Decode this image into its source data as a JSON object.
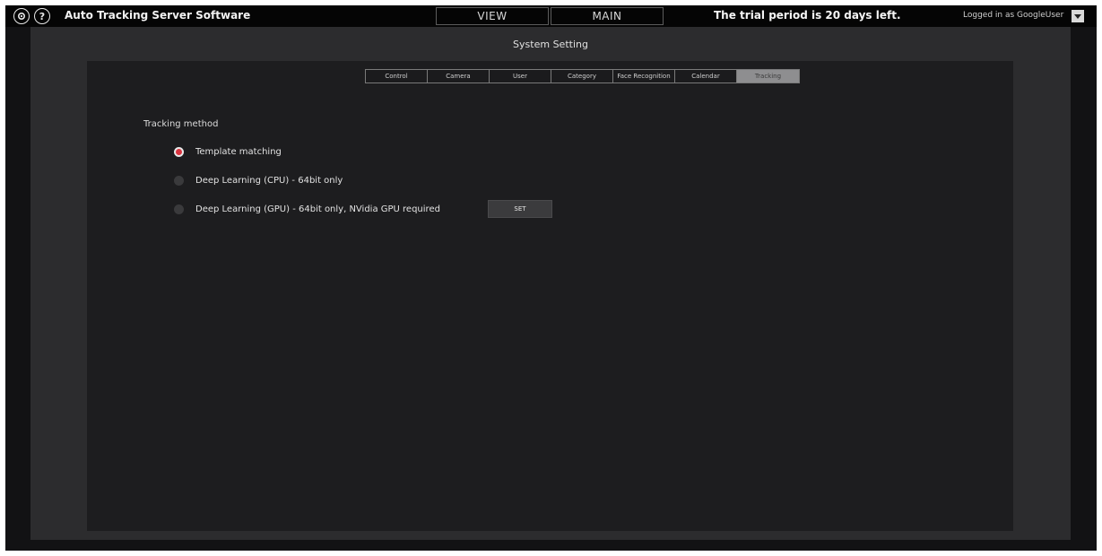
{
  "header": {
    "app_title": "Auto Tracking Server Software",
    "help_glyph": "?",
    "nav_tabs": [
      {
        "label": "VIEW"
      },
      {
        "label": "MAIN"
      }
    ],
    "trial_notice": "The trial period is 20 days left.",
    "login_text": "Logged in as GoogleUser",
    "icons": [
      "gear-icon",
      "help-icon",
      "chevron-down-icon"
    ]
  },
  "page": {
    "title": "System Setting"
  },
  "settings_tabs": [
    {
      "label": "Control",
      "active": false
    },
    {
      "label": "Camera",
      "active": false
    },
    {
      "label": "User",
      "active": false
    },
    {
      "label": "Category",
      "active": false
    },
    {
      "label": "Face Recognition",
      "active": false
    },
    {
      "label": "Calendar",
      "active": false
    },
    {
      "label": "Tracking",
      "active": true
    }
  ],
  "tracking": {
    "section_label": "Tracking method",
    "options": [
      {
        "label": "Template matching",
        "selected": true
      },
      {
        "label": "Deep Learning (CPU) - 64bit only",
        "selected": false
      },
      {
        "label": "Deep Learning (GPU) - 64bit only, NVidia GPU required",
        "selected": false
      }
    ],
    "set_button_label": "SET"
  },
  "colors": {
    "accent_radio": "#d9333f",
    "active_tab": "#8e8e90",
    "background": "#121214"
  }
}
